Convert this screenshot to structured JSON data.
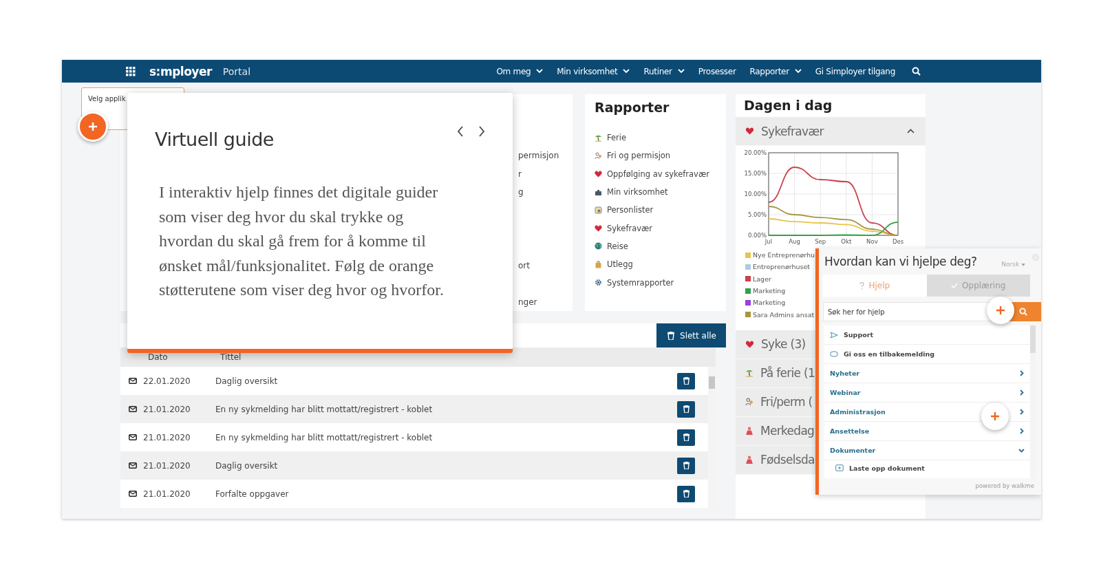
{
  "navbar": {
    "logo": "s:mployer",
    "portal": "Portal",
    "menu": [
      {
        "label": "Om meg",
        "dropdown": true
      },
      {
        "label": "Min virksomhet",
        "dropdown": true
      },
      {
        "label": "Rutiner",
        "dropdown": true
      },
      {
        "label": "Prosesser",
        "dropdown": false
      },
      {
        "label": "Rapporter",
        "dropdown": true
      },
      {
        "label": "Gi Simployer tilgang",
        "dropdown": false
      }
    ]
  },
  "app_tooltip": {
    "text": "Velg applik"
  },
  "hidden_card_fragments": [
    "permisjon",
    "r",
    "g",
    "ort",
    "nger"
  ],
  "rapporter": {
    "title": "Rapporter",
    "items": [
      "Ferie",
      "Fri og permisjon",
      "Oppfølging av sykefravær",
      "Min virksomhet",
      "Personlister",
      "Sykefravær",
      "Reise",
      "Utlegg",
      "Systemrapporter"
    ]
  },
  "messages": {
    "delete_all": "Slett alle",
    "columns": [
      "Dato",
      "Tittel"
    ],
    "rows": [
      {
        "date": "22.01.2020",
        "title": "Daglig oversikt"
      },
      {
        "date": "21.01.2020",
        "title": "En ny sykmelding har blitt mottatt/registrert - koblet"
      },
      {
        "date": "21.01.2020",
        "title": "En ny sykmelding har blitt mottatt/registrert - koblet"
      },
      {
        "date": "21.01.2020",
        "title": "Daglig oversikt"
      },
      {
        "date": "21.01.2020",
        "title": "Forfalte oppgaver"
      }
    ]
  },
  "dagen": {
    "title": "Dagen i dag",
    "section": {
      "label": "Sykefravær",
      "expanded": true
    },
    "chart_data": {
      "type": "line",
      "grid": true,
      "categories": [
        "Jul",
        "Aug",
        "Sep",
        "Okt",
        "Nov",
        "Des"
      ],
      "ylim": [
        0,
        20
      ],
      "yticks": [
        {
          "value": 0,
          "label": "0.00%"
        },
        {
          "value": 5,
          "label": "5.00%"
        },
        {
          "value": 10,
          "label": "10.00%"
        },
        {
          "value": 15,
          "label": "15.00%"
        },
        {
          "value": 20,
          "label": "20.00%"
        }
      ],
      "series": [
        {
          "name": "Nye Entreprenørhu",
          "color": "#e8c44a",
          "values": [
            4,
            3.3,
            3,
            2.6,
            1,
            0
          ]
        },
        {
          "name": "Entreprenørhuset",
          "color": "#a9cde8",
          "values": [
            null,
            null,
            null,
            null,
            null,
            null
          ]
        },
        {
          "name": "Lager",
          "color": "#c9414b",
          "values": [
            8,
            16.5,
            13.5,
            13,
            3,
            0
          ]
        },
        {
          "name": "Marketing",
          "color": "#2fa24a",
          "values": [
            0,
            0,
            0,
            0.1,
            0,
            3.2
          ]
        },
        {
          "name": "Marketing",
          "color": "#9b3fe0",
          "values": [
            null,
            null,
            null,
            null,
            null,
            null
          ]
        },
        {
          "name": "Sara Admins ansat",
          "color": "#a8963e",
          "values": [
            7,
            5,
            4.3,
            3.8,
            1.5,
            0
          ]
        }
      ]
    },
    "rows": [
      "Syke (3)",
      "På ferie (1",
      "Fri/perm (",
      "Merkedag",
      "Fødselsda"
    ]
  },
  "guide": {
    "title": "Virtuell guide",
    "body": "I interaktiv hjelp finnes det digitale guider som viser deg hvor du skal trykke og hvordan du skal gå frem for å komme til ønsket mål/funksjonalitet. Følg de orange støtterutene som viser deg hvor og hvorfor."
  },
  "help": {
    "title": "Hvordan kan vi hjelpe deg?",
    "language": "Norsk",
    "tabs": [
      {
        "label": "Hjelp",
        "selected": true
      },
      {
        "label": "Opplæring",
        "selected": false
      }
    ],
    "search": {
      "placeholder": "Søk her for hjelp"
    },
    "items": [
      {
        "kind": "link",
        "label": "Support"
      },
      {
        "kind": "link",
        "label": "Gi oss en tilbakemelding"
      },
      {
        "kind": "category",
        "label": "Nyheter",
        "expanded": false
      },
      {
        "kind": "category",
        "label": "Webinar",
        "expanded": false
      },
      {
        "kind": "category",
        "label": "Administrasjon",
        "expanded": false
      },
      {
        "kind": "category",
        "label": "Ansettelse",
        "expanded": false
      },
      {
        "kind": "category",
        "label": "Dokumenter",
        "expanded": true,
        "children": [
          {
            "label": "Laste opp dokument"
          }
        ]
      }
    ],
    "footer": "powered by walkme"
  }
}
